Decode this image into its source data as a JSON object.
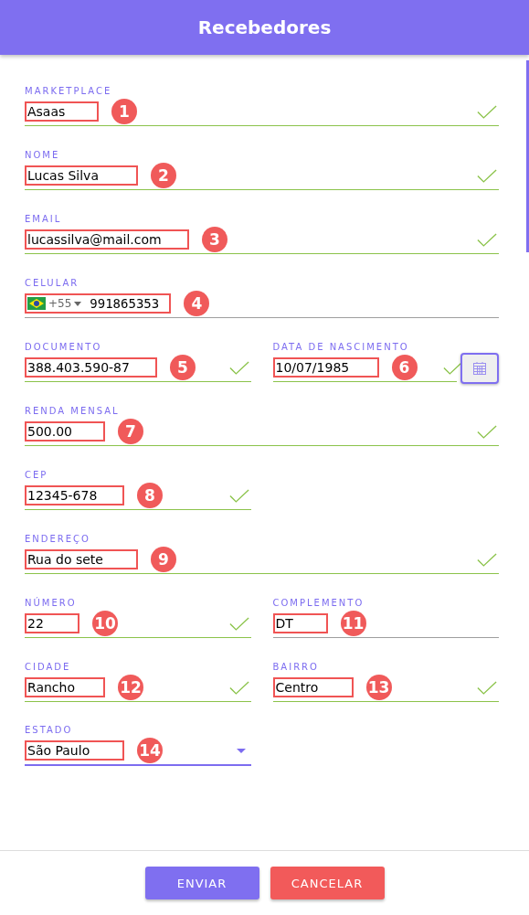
{
  "header": {
    "title": "Recebedores"
  },
  "rows": [
    {
      "fields": [
        {
          "kind": "text",
          "label": "MARKETPLACE",
          "value": "Asaas",
          "marker": "1",
          "valid": true
        }
      ]
    },
    {
      "fields": [
        {
          "kind": "text",
          "label": "NOME",
          "value": "Lucas Silva",
          "marker": "2",
          "valid": true
        }
      ]
    },
    {
      "fields": [
        {
          "kind": "text",
          "label": "EMAIL",
          "value": "lucassilva@mail.com",
          "marker": "3",
          "valid": true
        }
      ]
    },
    {
      "fields": [
        {
          "kind": "phone",
          "label": "CELULAR",
          "code": "+55",
          "value": "991865353",
          "marker": "4",
          "valid": false
        }
      ]
    },
    {
      "fields": [
        {
          "kind": "text",
          "label": "DOCUMENTO",
          "value": "388.403.590-87",
          "marker": "5",
          "valid": true
        },
        {
          "kind": "date",
          "label": "DATA DE NASCIMENTO",
          "value": "10/07/1985",
          "marker": "6",
          "valid": true
        }
      ]
    },
    {
      "fields": [
        {
          "kind": "text",
          "label": "RENDA MENSAL",
          "value": "500.00",
          "marker": "7",
          "valid": true
        }
      ]
    },
    {
      "fields": [
        {
          "kind": "text",
          "label": "CEP",
          "value": "12345-678",
          "marker": "8",
          "valid": true
        },
        {
          "kind": "empty"
        }
      ]
    },
    {
      "fields": [
        {
          "kind": "text",
          "label": "ENDEREÇO",
          "value": "Rua do sete",
          "marker": "9",
          "valid": true
        }
      ]
    },
    {
      "fields": [
        {
          "kind": "text",
          "label": "NÚMERO",
          "value": "22",
          "marker": "10",
          "valid": true
        },
        {
          "kind": "text",
          "label": "COMPLEMENTO",
          "value": "DT",
          "marker": "11",
          "valid": false
        }
      ]
    },
    {
      "fields": [
        {
          "kind": "text",
          "label": "CIDADE",
          "value": "Rancho",
          "marker": "12",
          "valid": true
        },
        {
          "kind": "text",
          "label": "BAIRRO",
          "value": "Centro",
          "marker": "13",
          "valid": true
        }
      ]
    },
    {
      "fields": [
        {
          "kind": "select",
          "label": "ESTADO",
          "value": "São Paulo",
          "marker": "14",
          "valid": false
        },
        {
          "kind": "empty"
        }
      ]
    }
  ],
  "buttons": [
    {
      "kind": "primary",
      "label": "ENVIAR"
    },
    {
      "kind": "danger",
      "label": "CANCELAR"
    }
  ]
}
